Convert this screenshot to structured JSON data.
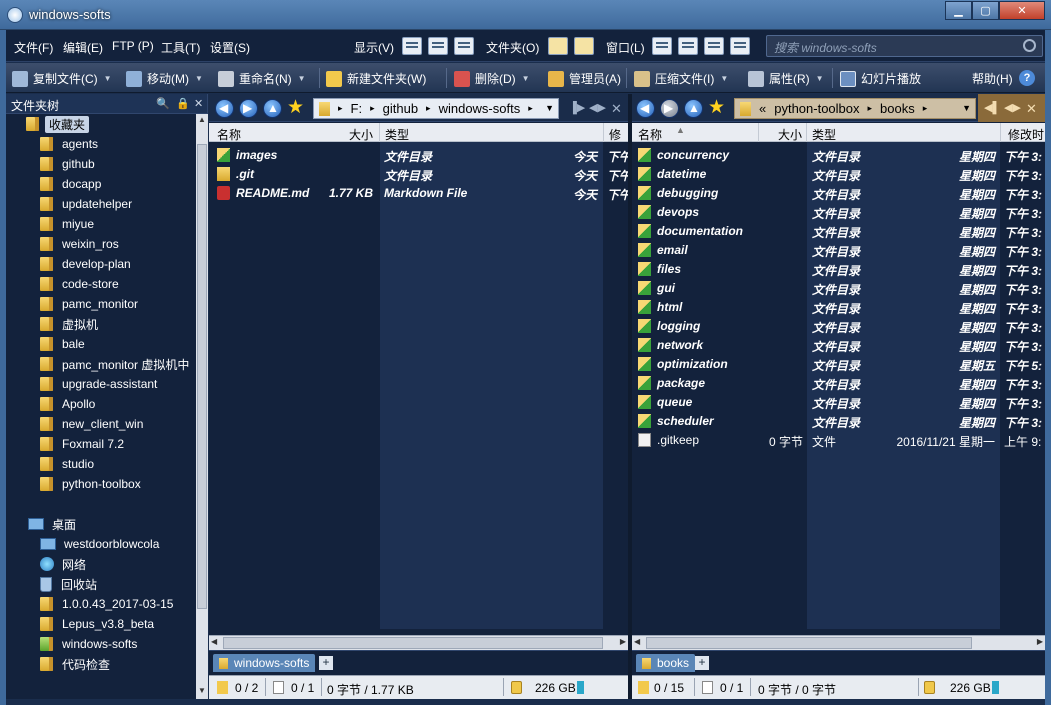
{
  "window": {
    "title": "windows-softs",
    "min": "▁",
    "max": "▢",
    "close": "✕"
  },
  "menu": {
    "file": "文件(F)",
    "edit": "编辑(E)",
    "ftp": "FTP (P)",
    "tools": "工具(T)",
    "settings": "设置(S)",
    "display": "显示(V)",
    "folder": "文件夹(O)",
    "window": "窗口(L)",
    "search_placeholder": "搜索 windows-softs"
  },
  "toolbar": {
    "copy": "复制文件(C)",
    "move": "移动(M)",
    "rename": "重命名(N)",
    "newfolder": "新建文件夹(W)",
    "delete": "删除(D)",
    "admin": "管理员(A)",
    "compress": "压缩文件(I)",
    "props": "属性(R)",
    "slideshow": "幻灯片播放",
    "help": "帮助(H)",
    "help_icon": "?"
  },
  "tree": {
    "header": "文件夹树",
    "favorites": "收藏夹",
    "items": [
      "agents",
      "github",
      "docapp",
      "updatehelper",
      "miyue",
      "weixin_ros",
      "develop-plan",
      "code-store",
      "pamc_monitor",
      "虚拟机",
      "bale",
      "pamc_monitor 虚拟机中",
      "upgrade-assistant",
      "Apollo",
      "new_client_win",
      "Foxmail 7.2",
      "studio",
      "python-toolbox"
    ],
    "desktop": "桌面",
    "desktop_items": [
      {
        "name": "westdoorblowcola",
        "icon": "computer-icon"
      },
      {
        "name": "网络",
        "icon": "network-icon"
      },
      {
        "name": "回收站",
        "icon": "recycle-bin-icon"
      },
      {
        "name": "1.0.0.43_2017-03-15",
        "icon": "folder-icon"
      },
      {
        "name": "Lepus_v3.8_beta",
        "icon": "folder-icon"
      },
      {
        "name": "windows-softs",
        "icon": "git-folder-icon"
      },
      {
        "name": "代码检查",
        "icon": "folder-icon"
      }
    ]
  },
  "left": {
    "path": [
      "F:",
      "github",
      "windows-softs"
    ],
    "columns": {
      "name": "名称",
      "size": "大小",
      "type": "类型",
      "modified": "修"
    },
    "rows": [
      {
        "name": "images",
        "size": "",
        "type": "文件目录",
        "date": "今天",
        "time": "下午",
        "icon": "git-folder"
      },
      {
        "name": ".git",
        "size": "",
        "type": "文件目录",
        "date": "今天",
        "time": "下午",
        "icon": "folder"
      },
      {
        "name": "README.md",
        "size": "1.77 KB",
        "type": "Markdown File",
        "date": "今天",
        "time": "下午",
        "icon": "markdown"
      }
    ],
    "tab": "windows-softs",
    "status": {
      "folders": "0 / 2",
      "files": "0 / 1",
      "bytes": "0 字节 / 1.77 KB",
      "free": "226 GB"
    }
  },
  "right": {
    "path": [
      "«",
      "python-toolbox",
      "books"
    ],
    "columns": {
      "name": "名称",
      "size": "大小",
      "type": "类型",
      "modified": "修改时"
    },
    "rows": [
      {
        "name": "concurrency",
        "size": "",
        "type": "文件目录",
        "date": "星期四",
        "time": "下午 3:"
      },
      {
        "name": "datetime",
        "size": "",
        "type": "文件目录",
        "date": "星期四",
        "time": "下午 3:"
      },
      {
        "name": "debugging",
        "size": "",
        "type": "文件目录",
        "date": "星期四",
        "time": "下午 3:"
      },
      {
        "name": "devops",
        "size": "",
        "type": "文件目录",
        "date": "星期四",
        "time": "下午 3:"
      },
      {
        "name": "documentation",
        "size": "",
        "type": "文件目录",
        "date": "星期四",
        "time": "下午 3:"
      },
      {
        "name": "email",
        "size": "",
        "type": "文件目录",
        "date": "星期四",
        "time": "下午 3:"
      },
      {
        "name": "files",
        "size": "",
        "type": "文件目录",
        "date": "星期四",
        "time": "下午 3:"
      },
      {
        "name": "gui",
        "size": "",
        "type": "文件目录",
        "date": "星期四",
        "time": "下午 3:"
      },
      {
        "name": "html",
        "size": "",
        "type": "文件目录",
        "date": "星期四",
        "time": "下午 3:"
      },
      {
        "name": "logging",
        "size": "",
        "type": "文件目录",
        "date": "星期四",
        "time": "下午 3:"
      },
      {
        "name": "network",
        "size": "",
        "type": "文件目录",
        "date": "星期四",
        "time": "下午 3:"
      },
      {
        "name": "optimization",
        "size": "",
        "type": "文件目录",
        "date": "星期五",
        "time": "下午 5:"
      },
      {
        "name": "package",
        "size": "",
        "type": "文件目录",
        "date": "星期四",
        "time": "下午 3:"
      },
      {
        "name": "queue",
        "size": "",
        "type": "文件目录",
        "date": "星期四",
        "time": "下午 3:"
      },
      {
        "name": "scheduler",
        "size": "",
        "type": "文件目录",
        "date": "星期四",
        "time": "下午 3:"
      },
      {
        "name": ".gitkeep",
        "size": "0 字节",
        "type": "文件",
        "date": "2016/11/21 星期一",
        "time": "上午 9:"
      }
    ],
    "tab": "books",
    "status": {
      "folders": "0 / 15",
      "files": "0 / 1",
      "bytes": "0 字节 / 0 字节",
      "free": "226 GB"
    }
  },
  "colors": {
    "bg": "#13223c",
    "accent": "#5a86b7",
    "folder": "#f2c94c"
  }
}
